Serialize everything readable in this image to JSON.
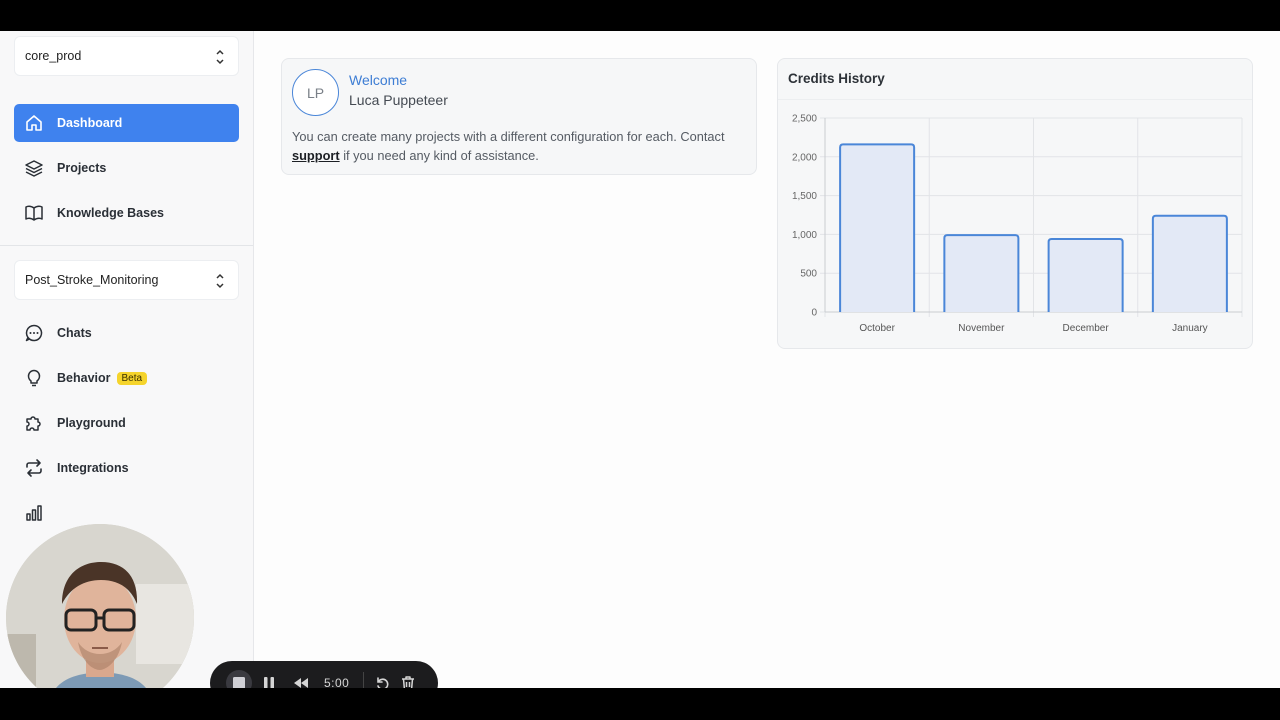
{
  "sidebar": {
    "workspace_select": "core_prod",
    "top_nav": [
      {
        "label": "Dashboard",
        "icon": "home-icon",
        "active": true
      },
      {
        "label": "Projects",
        "icon": "layers-icon"
      },
      {
        "label": "Knowledge Bases",
        "icon": "book-icon"
      }
    ],
    "project_select": "Post_Stroke_Monitoring",
    "project_nav": [
      {
        "label": "Chats",
        "icon": "chat-bubble-icon"
      },
      {
        "label": "Behavior",
        "icon": "lightbulb-icon",
        "badge": "Beta"
      },
      {
        "label": "Playground",
        "icon": "puzzle-icon"
      },
      {
        "label": "Integrations",
        "icon": "repeat-icon"
      },
      {
        "label": "",
        "icon": "bar-chart-icon"
      }
    ]
  },
  "welcome_card": {
    "avatar_initials": "LP",
    "greeting": "Welcome",
    "user_name": "Luca Puppeteer",
    "message_before": "You can create many projects with a different configuration for each. Contact ",
    "support_link": "support",
    "message_after": " if you need any kind of assistance."
  },
  "credits_card": {
    "title": "Credits History"
  },
  "chart_data": {
    "type": "bar",
    "title": "Credits History",
    "categories": [
      "October",
      "November",
      "December",
      "January"
    ],
    "values": [
      2160,
      990,
      940,
      1240
    ],
    "ylim": [
      0,
      2500
    ],
    "yticks": [
      0,
      500,
      1000,
      1500,
      2000,
      2500
    ],
    "ytick_labels": [
      "0",
      "500",
      "1,000",
      "1,500",
      "2,000",
      "2,500"
    ],
    "grid": true,
    "bar_fill": "#e3e9f6",
    "bar_stroke": "#4a86d8"
  },
  "recorder": {
    "time": "5:00"
  },
  "colors": {
    "accent": "#3f82ee",
    "badge": "#f5d42c",
    "link": "#3d7dd4"
  }
}
